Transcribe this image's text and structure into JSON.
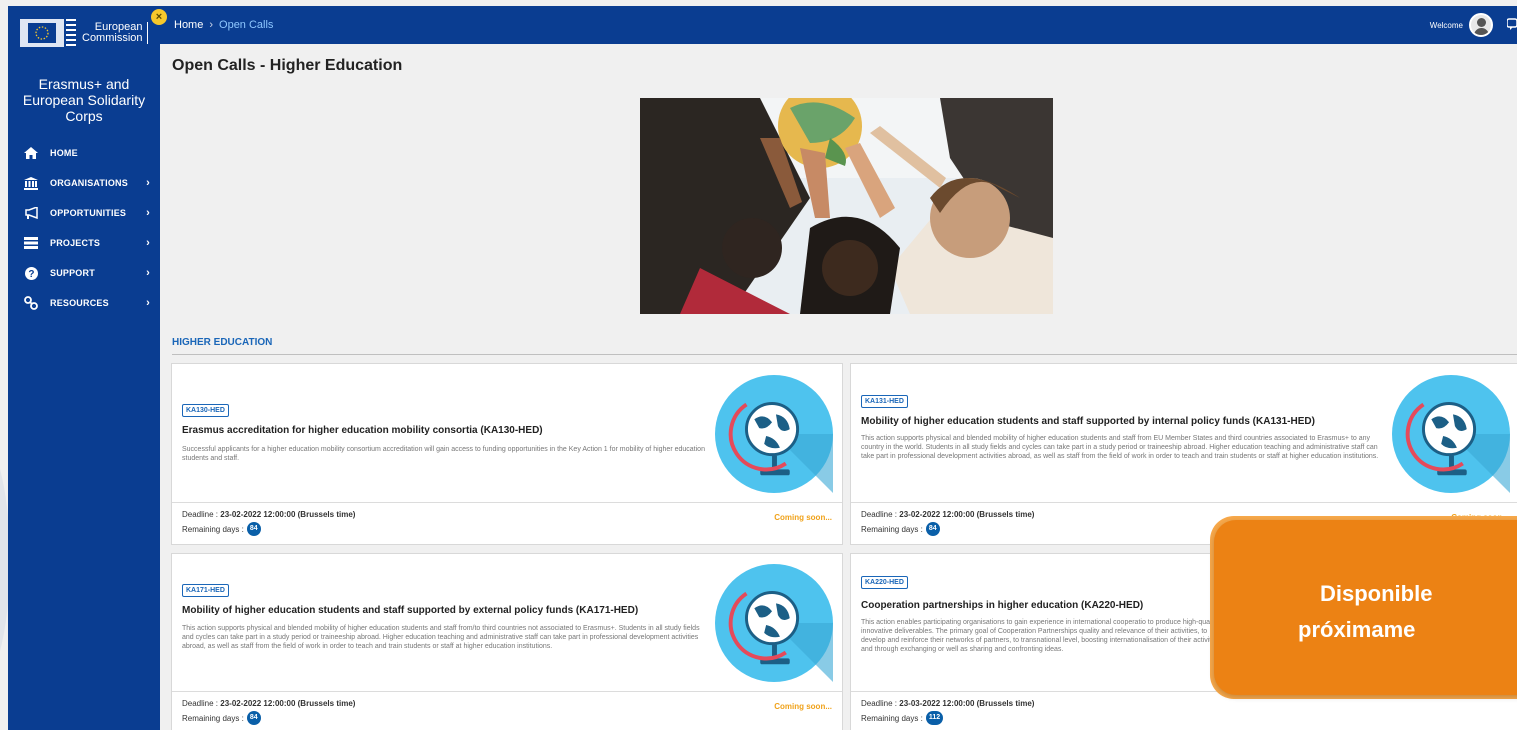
{
  "sidebar": {
    "logo_line1": "European",
    "logo_line2": "Commission",
    "app_name": "Erasmus+ and European Solidarity Corps",
    "items": [
      {
        "label": "HOME",
        "icon": "home-icon",
        "has_chevron": false
      },
      {
        "label": "ORGANISATIONS",
        "icon": "institution-icon",
        "has_chevron": true
      },
      {
        "label": "OPPORTUNITIES",
        "icon": "megaphone-icon",
        "has_chevron": true
      },
      {
        "label": "PROJECTS",
        "icon": "list-icon",
        "has_chevron": true
      },
      {
        "label": "SUPPORT",
        "icon": "help-icon",
        "has_chevron": true
      },
      {
        "label": "RESOURCES",
        "icon": "link-icon",
        "has_chevron": true
      }
    ]
  },
  "topbar": {
    "breadcrumb_home": "Home",
    "breadcrumb_separator": "›",
    "breadcrumb_current": "Open Calls",
    "welcome": "Welcome"
  },
  "page": {
    "title": "Open Calls - Higher Education",
    "section_title": "HIGHER EDUCATION"
  },
  "cards": [
    {
      "code": "KA130-HED",
      "title": "Erasmus accreditation for higher education mobility consortia (KA130-HED)",
      "description": "Successful applicants for a higher education mobility consortium accreditation will gain access to funding opportunities in the Key Action 1 for mobility of higher education students and staff.",
      "deadline_label": "Deadline : ",
      "deadline": "23-02-2022 12:00:00 (Brussels time)",
      "remaining_label": "Remaining days :",
      "remaining_days": "84",
      "status": "Coming soon..."
    },
    {
      "code": "KA131-HED",
      "title": "Mobility of higher education students and staff supported by internal policy funds (KA131-HED)",
      "description": "This action supports physical and blended mobility of higher education students and staff from EU Member States and third countries associated to Erasmus+ to any country in the world. Students in all study fields and cycles can take part in a study period or traineeship abroad. Higher education teaching and administrative staff can take part in professional development activities abroad, as well as staff from the field of work in order to teach and train students or staff at higher education institutions.",
      "deadline_label": "Deadline : ",
      "deadline": "23-02-2022 12:00:00 (Brussels time)",
      "remaining_label": "Remaining days :",
      "remaining_days": "84",
      "status": "Coming soon..."
    },
    {
      "code": "KA171-HED",
      "title": "Mobility of higher education students and staff supported by external policy funds (KA171-HED)",
      "description": "This action supports physical and blended mobility of higher education students and staff from/to third countries not associated to Erasmus+. Students in all study fields and cycles can take part in a study period or traineeship abroad. Higher education teaching and administrative staff can take part in professional development activities abroad, as well as staff from the field of work in order to teach and train students or staff at higher education institutions.",
      "deadline_label": "Deadline : ",
      "deadline": "23-02-2022 12:00:00 (Brussels time)",
      "remaining_label": "Remaining days :",
      "remaining_days": "84",
      "status": "Coming soon..."
    },
    {
      "code": "KA220-HED",
      "title": "Cooperation partnerships in higher education (KA220-HED)",
      "description": "This action enables participating organisations to gain experience in international cooperatio to produce high-quality innovative deliverables. The primary goal of Cooperation Partnerships quality and relevance of their activities, to develop and reinforce their networks of partners, to transnational level, boosting internationalisation of their activities and through exchanging or well as sharing and confronting ideas.",
      "deadline_label": "Deadline : ",
      "deadline": "23-03-2022 12:00:00 (Brussels time)",
      "remaining_label": "Remaining days :",
      "remaining_days": "112",
      "status": ""
    }
  ],
  "promo": {
    "line1": "Disponible",
    "line2": "próximame"
  },
  "colors": {
    "brand_blue": "#0a3d91",
    "link_blue": "#1a66b8",
    "coming_soon": "#f0a21a",
    "promo_orange": "#ec8214",
    "globe_circle": "#4ec3ee"
  }
}
